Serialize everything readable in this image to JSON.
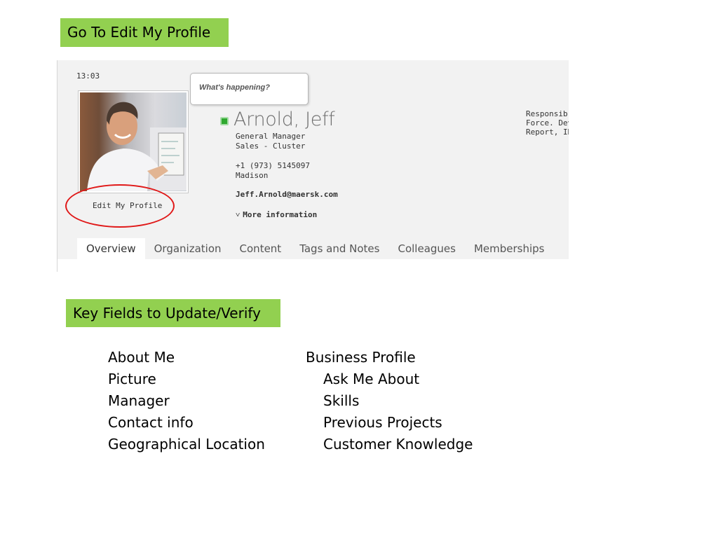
{
  "labels": {
    "top": "Go To Edit My Profile",
    "key_fields": "Key Fields to Update/Verify"
  },
  "profile": {
    "time": "13:03",
    "status_prompt": "What's happening?",
    "name": "Arnold, Jeff",
    "job_title": "General Manager",
    "department": "Sales - Cluster",
    "phone": "+1 (973) 5145097",
    "city": "Madison",
    "email": "Jeff.Arnold@maersk.com",
    "more_info": "More information",
    "edit_link": "Edit My Profile",
    "right_text": [
      "Responsib",
      "Force. Dev",
      "Report, IN"
    ],
    "status_color": "#2fa82f",
    "highlight_color": "#e01818"
  },
  "tabs": [
    {
      "label": "Overview",
      "active": true
    },
    {
      "label": "Organization",
      "active": false
    },
    {
      "label": "Content",
      "active": false
    },
    {
      "label": "Tags and Notes",
      "active": false
    },
    {
      "label": "Colleagues",
      "active": false
    },
    {
      "label": "Memberships",
      "active": false
    }
  ],
  "fields_left": [
    "About Me",
    "Picture",
    "Manager",
    "Contact info",
    "Geographical Location"
  ],
  "fields_right": {
    "heading": "Business Profile",
    "items": [
      "Ask Me About",
      "Skills",
      "Previous Projects",
      "Customer Knowledge"
    ]
  },
  "accent_color": "#92d050"
}
